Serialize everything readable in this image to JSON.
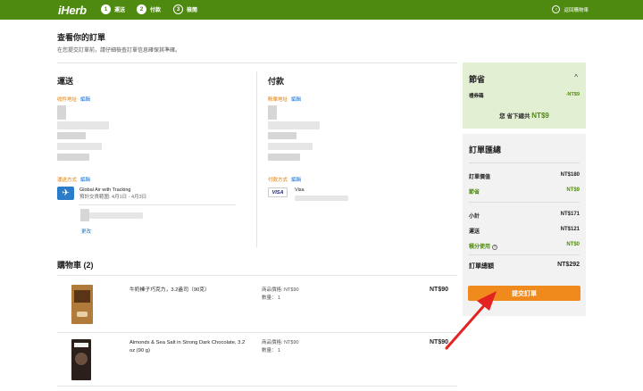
{
  "header": {
    "logo": "iHerb",
    "steps": [
      {
        "num": "1",
        "label": "運送"
      },
      {
        "num": "2",
        "label": "付款"
      },
      {
        "num": "3",
        "label": "檢閱"
      }
    ],
    "back_label": "返回購物車",
    "back_icon": "chevron-left-icon",
    "bg_color": "#4f8a10"
  },
  "page": {
    "title": "查看你的訂單",
    "subtitle": "在您提交訂單前，請仔細檢查訂單信息確保其準確。"
  },
  "shipping": {
    "title": "運送",
    "address_label": "收件地址",
    "edit_label": "編輯",
    "method_label": "運送方式",
    "method_name": "Global Air with Tracking",
    "method_date": "預計交貨範圍: 4月1日 - 4月3日",
    "change_label": "更改",
    "plane_icon": "airplane-icon"
  },
  "payment": {
    "title": "付款",
    "billing_label": "賬單地址",
    "edit_label": "編輯",
    "method_label": "付款方式",
    "card_logo": "VISA",
    "card_name": "Visa"
  },
  "cart": {
    "title": "購物車 (2)",
    "items": [
      {
        "name": "牛奶榛子巧克力，3.2盎司（90克）",
        "price_label": "商品價格: NT$90",
        "qty_label": "數量： 1",
        "total": "NT$90"
      },
      {
        "name": "Almonds & Sea Salt in Strong Dark Chocolate, 3.2 oz (90 g)",
        "price_label": "商品價格: NT$90",
        "qty_label": "數量： 1",
        "total": "NT$90"
      }
    ]
  },
  "savings": {
    "title": "節省",
    "coupon_label": "禮券碼",
    "coupon_value": "-NT$9",
    "note_prefix": "您 省下總共",
    "note_amount": "NT$9"
  },
  "summary": {
    "title": "訂單匯總",
    "order_value_label": "訂單價值",
    "order_value": "NT$180",
    "savings_label": "節省",
    "savings_value": "NT$9",
    "subtotal_label": "小計",
    "subtotal_value": "NT$171",
    "shipping_label": "運送",
    "shipping_value": "NT$121",
    "rewards_label": "積分使用",
    "rewards_value": "NT$0",
    "total_label": "訂單總額",
    "total_value": "NT$292",
    "submit_label": "提交訂單",
    "accent_color": "#f08a1c",
    "green_color": "#4f8a10"
  }
}
